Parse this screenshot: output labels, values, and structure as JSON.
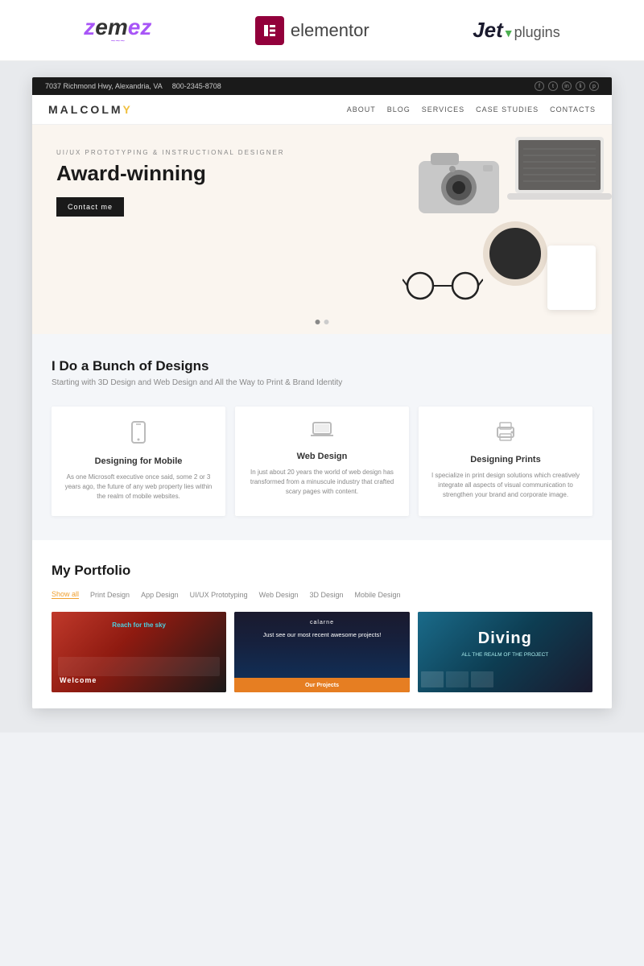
{
  "brands": {
    "zemes": "Zem",
    "zemes_accent": "ez",
    "elementor": "elementor",
    "jet": "Jet",
    "jet_suffix": "plugins"
  },
  "topbar": {
    "address": "7037 Richmond Hwy, Alexandria, VA",
    "phone": "800-2345-8708"
  },
  "nav": {
    "brand": "MALCOLMY",
    "links": [
      "ABOUT",
      "BLOG",
      "SERVICES",
      "CASE STUDIES",
      "CONTACTS"
    ]
  },
  "hero": {
    "subtitle": "UI/UX PROTOTYPING & INSTRUCTIONAL DESIGNER",
    "title": "Award-winning",
    "cta": "Contact me"
  },
  "services": {
    "heading": "I Do a Bunch of Designs",
    "subheading": "Starting with 3D Design and Web Design and All the Way to Print & Brand Identity",
    "cards": [
      {
        "title": "Designing for Mobile",
        "icon": "📱",
        "text": "As one Microsoft executive once said, some 2 or 3 years ago, the future of any web property lies within the realm of mobile websites."
      },
      {
        "title": "Web Design",
        "icon": "💻",
        "text": "In just about 20 years the world of web design has transformed from a minuscule industry that crafted scary pages with content."
      },
      {
        "title": "Designing Prints",
        "icon": "🖨",
        "text": "I specialize in print design solutions which creatively integrate all aspects of visual communication to strengthen your brand and corporate image."
      }
    ]
  },
  "portfolio": {
    "heading": "My Portfolio",
    "filters": [
      "Show all",
      "Print Design",
      "App Design",
      "UI/UX Prototyping",
      "Web Design",
      "3D Design",
      "Mobile Design"
    ],
    "items": [
      {
        "text": "Reach for the sky",
        "label": "Welcome"
      },
      {
        "text": "Just see our most recent awesome projects!",
        "label": "Our Projects"
      },
      {
        "text": "Diving",
        "label": ""
      }
    ]
  }
}
